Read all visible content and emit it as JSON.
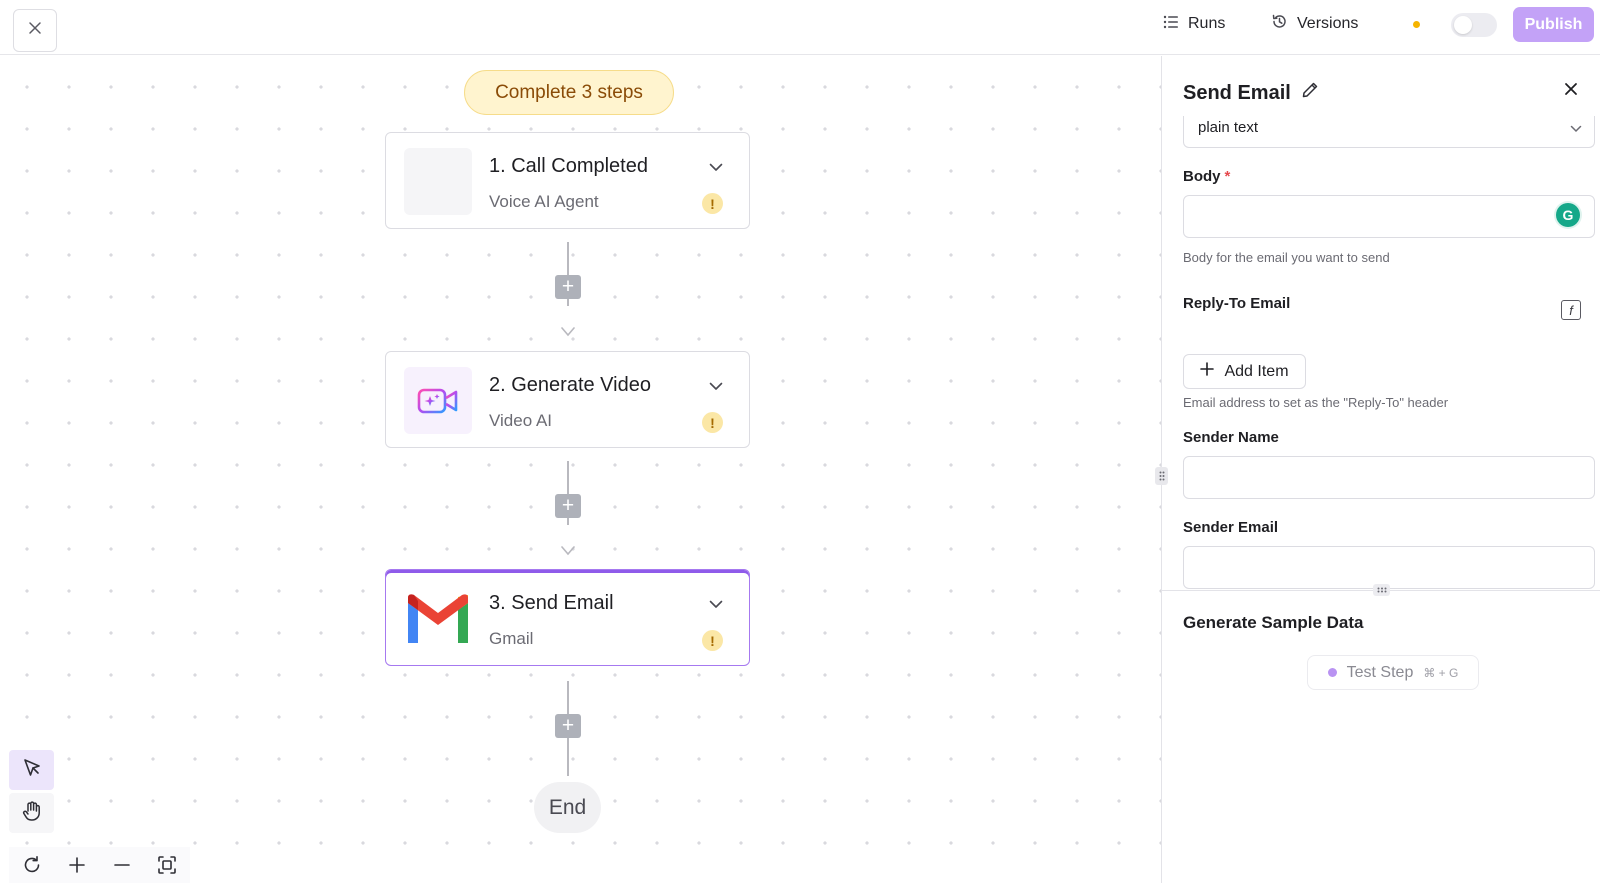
{
  "topbar": {
    "runs_label": "Runs",
    "versions_label": "Versions",
    "publish_label": "Publish"
  },
  "canvas": {
    "steps_pill": "Complete 3 steps",
    "steps": [
      {
        "title": "1. Call Completed",
        "subtitle": "Voice AI Agent",
        "icon": "blank-icon",
        "warning": "!"
      },
      {
        "title": "2. Generate Video",
        "subtitle": "Video AI",
        "icon": "video-ai-icon",
        "warning": "!"
      },
      {
        "title": "3. Send Email",
        "subtitle": "Gmail",
        "icon": "gmail-icon",
        "warning": "!"
      }
    ],
    "end_label": "End",
    "add_symbol": "+"
  },
  "panel": {
    "title": "Send Email",
    "format_value": "plain text",
    "body_label": "Body",
    "required_mark": "*",
    "body_hint": "Body for the email you want to send",
    "grammarly_letter": "G",
    "reply_to_label": "Reply-To Email",
    "fx_symbol": "f",
    "add_item_label": "Add Item",
    "reply_to_hint": "Email address to set as the \"Reply-To\" header",
    "sender_name_label": "Sender Name",
    "sender_email_label": "Sender Email",
    "sample_section_title": "Generate Sample Data",
    "test_step_label": "Test Step",
    "test_step_shortcut": "⌘ + G"
  },
  "colors": {
    "accent": "#8f5bea",
    "publish_bg": "#c3a2f7",
    "pill_bg": "#fff4cf",
    "pill_text": "#8a4b07",
    "warning_bg": "#fbe7a6",
    "status_dot": "#f5b400"
  }
}
